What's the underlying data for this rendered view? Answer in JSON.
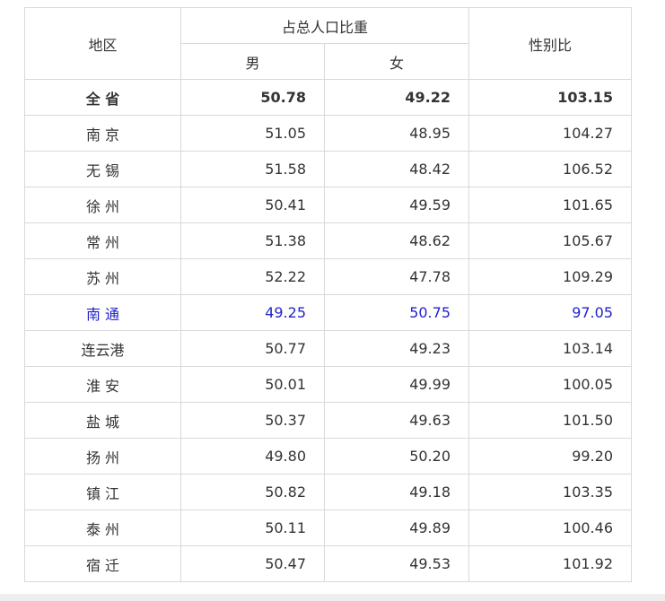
{
  "header": {
    "region": "地区",
    "share_group": "占总人口比重",
    "male": "男",
    "female": "女",
    "sex_ratio": "性别比"
  },
  "rows": [
    {
      "region": "全 省",
      "male": "50.78",
      "female": "49.22",
      "ratio": "103.15"
    },
    {
      "region": "南 京",
      "male": "51.05",
      "female": "48.95",
      "ratio": "104.27"
    },
    {
      "region": "无 锡",
      "male": "51.58",
      "female": "48.42",
      "ratio": "106.52"
    },
    {
      "region": "徐 州",
      "male": "50.41",
      "female": "49.59",
      "ratio": "101.65"
    },
    {
      "region": "常 州",
      "male": "51.38",
      "female": "48.62",
      "ratio": "105.67"
    },
    {
      "region": "苏 州",
      "male": "52.22",
      "female": "47.78",
      "ratio": "109.29"
    },
    {
      "region": "南 通",
      "male": "49.25",
      "female": "50.75",
      "ratio": "97.05"
    },
    {
      "region": "连云港",
      "male": "50.77",
      "female": "49.23",
      "ratio": "103.14"
    },
    {
      "region": "淮 安",
      "male": "50.01",
      "female": "49.99",
      "ratio": "100.05"
    },
    {
      "region": "盐 城",
      "male": "50.37",
      "female": "49.63",
      "ratio": "101.50"
    },
    {
      "region": "扬 州",
      "male": "49.80",
      "female": "50.20",
      "ratio": "99.20"
    },
    {
      "region": "镇 江",
      "male": "50.82",
      "female": "49.18",
      "ratio": "103.35"
    },
    {
      "region": "泰 州",
      "male": "50.11",
      "female": "49.89",
      "ratio": "100.46"
    },
    {
      "region": "宿 迁",
      "male": "50.47",
      "female": "49.53",
      "ratio": "101.92"
    }
  ],
  "colors": {
    "text": "#333333",
    "highlight": "#2222cc",
    "border": "#d9d9d9"
  }
}
